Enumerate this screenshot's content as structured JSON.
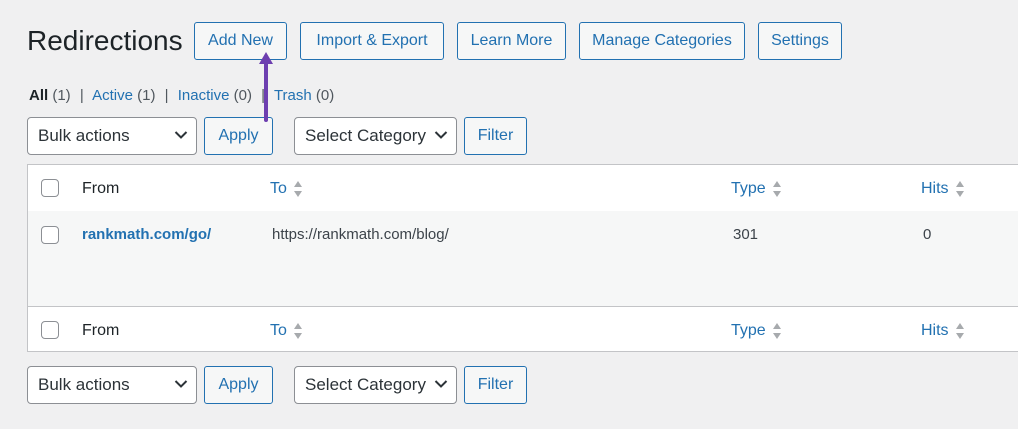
{
  "page": {
    "title": "Redirections",
    "header_buttons": [
      "Add New",
      "Import & Export",
      "Learn More",
      "Manage Categories",
      "Settings"
    ]
  },
  "filters": {
    "all_label": "All",
    "all_count": "(1)",
    "active_label": "Active",
    "active_count": "(1)",
    "inactive_label": "Inactive",
    "inactive_count": "(0)",
    "trash_label": "Trash",
    "trash_count": "(0)",
    "separator": "|"
  },
  "tablenav": {
    "bulk_actions": "Bulk actions",
    "apply": "Apply",
    "category": "Select Category",
    "filter": "Filter"
  },
  "table": {
    "columns": [
      "From",
      "To",
      "Type",
      "Hits"
    ],
    "rows": [
      {
        "from": "rankmath.com/go/",
        "to": "https://rankmath.com/blog/",
        "type": "301",
        "hits": "0"
      }
    ]
  },
  "colors": {
    "accent": "#2271b1",
    "arrow": "#6d3fb0",
    "background": "#f0f0f1"
  }
}
